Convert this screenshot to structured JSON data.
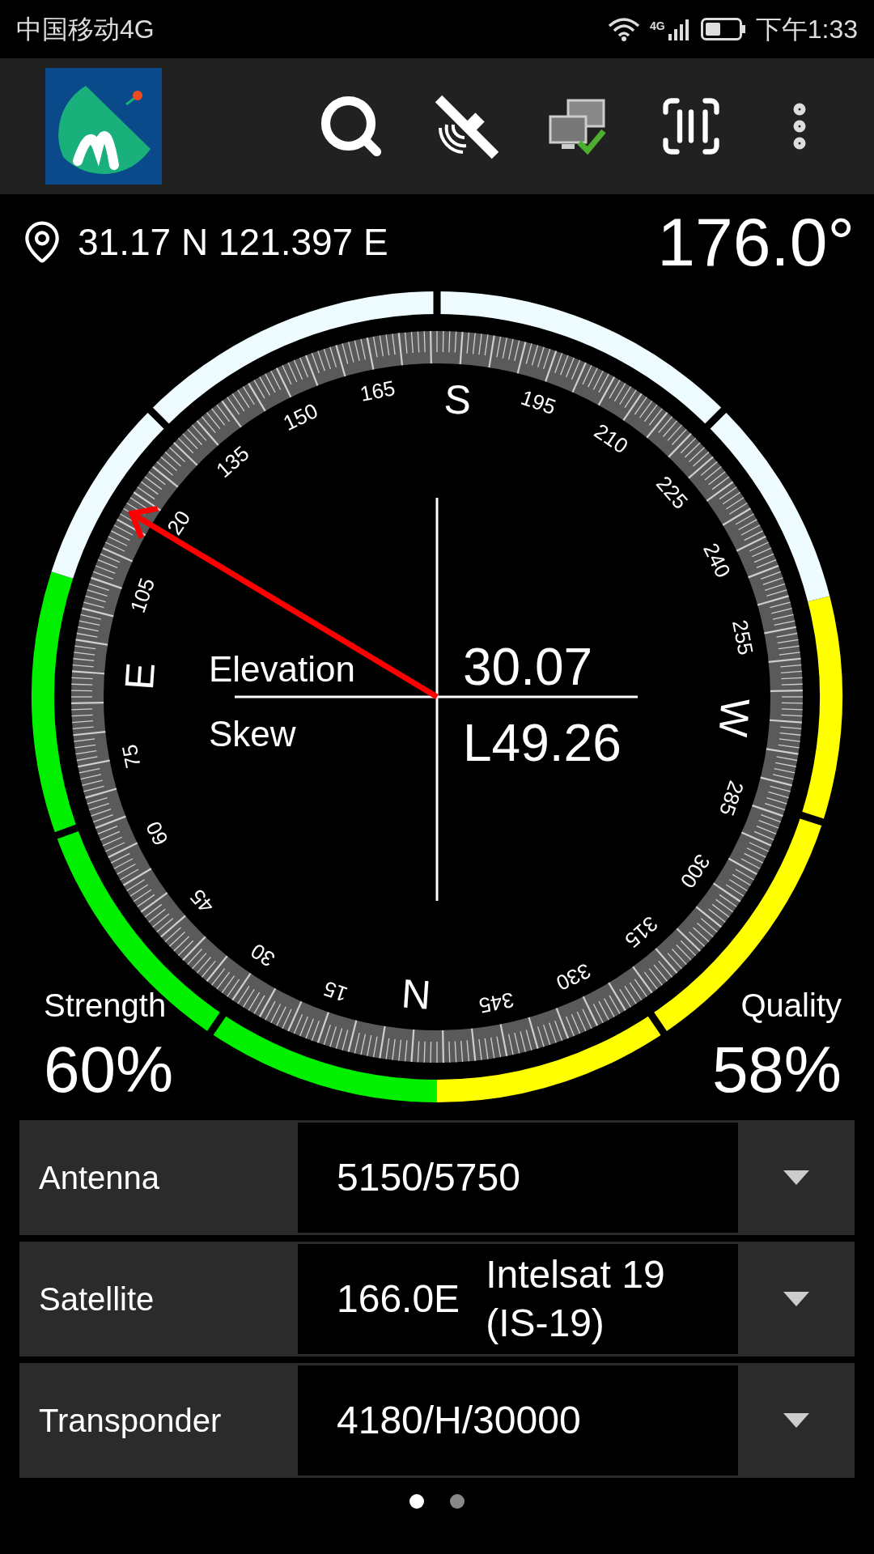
{
  "status_bar": {
    "carrier": "中国移动4G",
    "network": "4G",
    "time": "下午1:33"
  },
  "location": {
    "coordinates": "31.17 N 121.397 E",
    "heading": "176.0°"
  },
  "compass": {
    "labels": [
      "N",
      "15",
      "30",
      "45",
      "60",
      "75",
      "E",
      "105",
      "20",
      "135",
      "150",
      "165",
      "S",
      "195",
      "210",
      "225",
      "240",
      "255",
      "W",
      "285",
      "300",
      "315",
      "330",
      "345"
    ],
    "elevation_label": "Elevation",
    "elevation": "30.07",
    "skew_label": "Skew",
    "skew": "L49.26"
  },
  "strength": {
    "label": "Strength",
    "value": "60%"
  },
  "quality": {
    "label": "Quality",
    "value": "58%"
  },
  "rows": [
    {
      "label": "Antenna",
      "values": [
        "5150/5750"
      ]
    },
    {
      "label": "Satellite",
      "values": [
        "166.0E",
        "Intelsat 19 (IS-19)"
      ]
    },
    {
      "label": "Transponder",
      "values": [
        "4180/H/30000"
      ]
    }
  ],
  "pages": [
    {
      "selected": true
    },
    {
      "selected": false
    }
  ]
}
